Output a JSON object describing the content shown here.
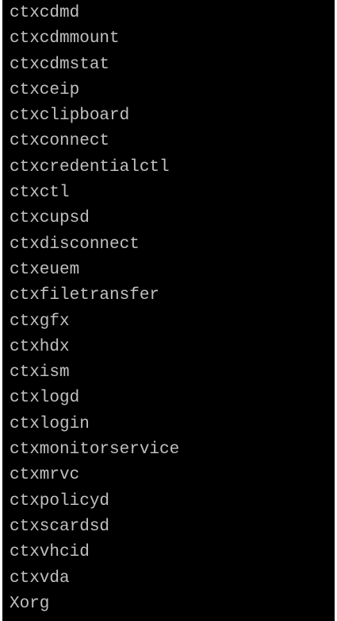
{
  "terminal": {
    "lines": [
      "ctxcdmd",
      "ctxcdmmount",
      "ctxcdmstat",
      "ctxceip",
      "ctxclipboard",
      "ctxconnect",
      "ctxcredentialctl",
      "ctxctl",
      "ctxcupsd",
      "ctxdisconnect",
      "ctxeuem",
      "ctxfiletransfer",
      "ctxgfx",
      "ctxhdx",
      "ctxism",
      "ctxlogd",
      "ctxlogin",
      "ctxmonitorservice",
      "ctxmrvc",
      "ctxpolicyd",
      "ctxscardsd",
      "ctxvhcid",
      "ctxvda",
      "Xorg"
    ],
    "colors": {
      "background": "#000000",
      "text": "#c0c0c0"
    }
  }
}
